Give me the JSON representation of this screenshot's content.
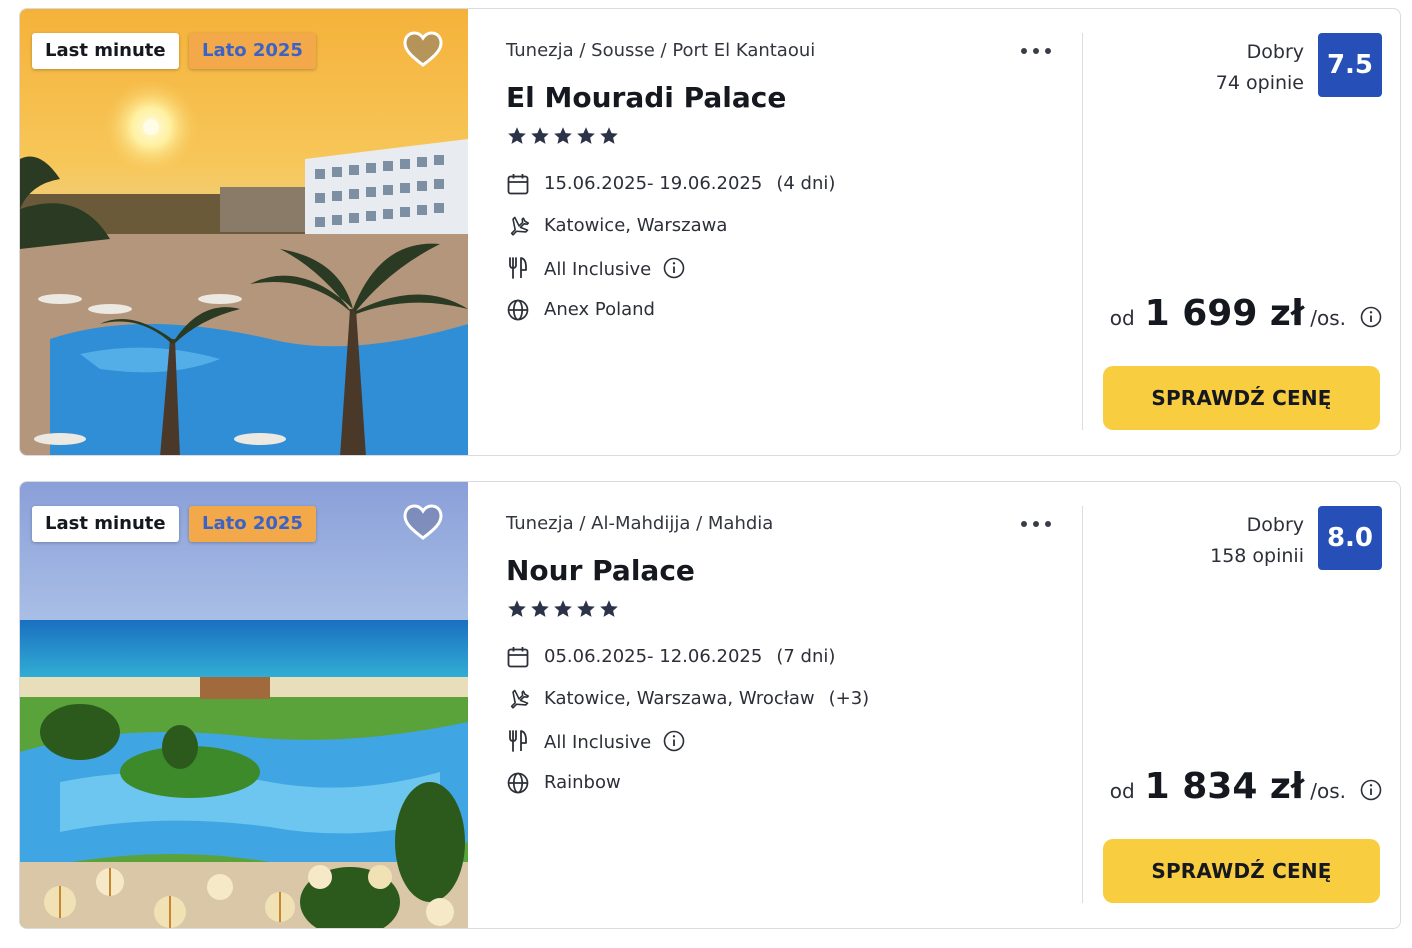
{
  "colors": {
    "score_bg": "#2650b8",
    "cta_bg": "#f8cd3f",
    "badge_season_bg": "#f3a94a",
    "badge_season_text": "#3b62c6",
    "star": "#2c3349"
  },
  "offers": [
    {
      "badge_primary": "Last minute",
      "badge_season": "Lato 2025",
      "location": "Tunezja / Sousse / Port El Kantaoui",
      "hotel_name": "El Mouradi Palace",
      "stars": 5,
      "dates": "15.06.2025- 19.06.2025",
      "duration": "(4 dni)",
      "departures": "Katowice, Warszawa",
      "departures_extra": "",
      "board": "All Inclusive",
      "operator": "Anex Poland",
      "rating_label": "Dobry",
      "reviews": "74 opinie",
      "score": "7.5",
      "price_prefix": "od",
      "price": "1 699 zł",
      "price_suffix": "/os.",
      "cta_label": "SPRAWDŹ CENĘ",
      "icons": {
        "favorite": "heart-icon",
        "more": "more-horizontal-icon",
        "dates": "calendar-icon",
        "departures": "plane-icon",
        "board": "cutlery-icon",
        "operator": "globe-icon",
        "info": "info-icon"
      }
    },
    {
      "badge_primary": "Last minute",
      "badge_season": "Lato 2025",
      "location": "Tunezja / Al-Mahdijja / Mahdia",
      "hotel_name": "Nour Palace",
      "stars": 5,
      "dates": "05.06.2025- 12.06.2025",
      "duration": "(7 dni)",
      "departures": "Katowice, Warszawa, Wrocław",
      "departures_extra": "(+3)",
      "board": "All Inclusive",
      "operator": "Rainbow",
      "rating_label": "Dobry",
      "reviews": "158 opinii",
      "score": "8.0",
      "price_prefix": "od",
      "price": "1 834 zł",
      "price_suffix": "/os.",
      "cta_label": "SPRAWDŹ CENĘ",
      "icons": {
        "favorite": "heart-icon",
        "more": "more-horizontal-icon",
        "dates": "calendar-icon",
        "departures": "plane-icon",
        "board": "cutlery-icon",
        "operator": "globe-icon",
        "info": "info-icon"
      }
    }
  ]
}
